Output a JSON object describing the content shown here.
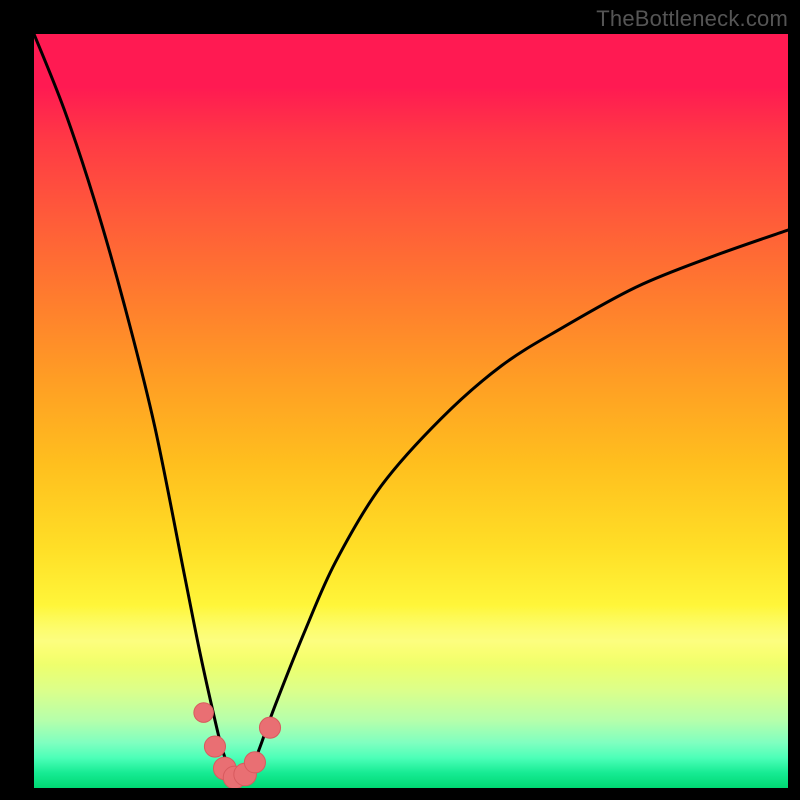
{
  "attribution": "TheBottleneck.com",
  "colors": {
    "curve_stroke": "#000000",
    "marker_fill": "#e96f73",
    "marker_stroke": "#d85a5e",
    "gradient_top": "#ff1a52",
    "gradient_bottom": "#00d873",
    "frame": "#000000"
  },
  "chart_data": {
    "type": "line",
    "title": "",
    "xlabel": "",
    "ylabel": "",
    "xlim": [
      0,
      100
    ],
    "ylim": [
      0,
      100
    ],
    "description": "V-shaped bottleneck curve on a vertical red-to-green gradient. Minimum (optimal, near-zero bottleneck) occurs around x≈27. Left branch rises steeply toward 100 at x=0; right branch rises with diminishing slope toward ~74 at x=100. A cluster of salmon-colored markers sits near the trough.",
    "series": [
      {
        "name": "bottleneck-curve",
        "x": [
          0,
          4,
          8,
          12,
          16,
          20,
          22,
          24,
          25,
          26,
          27,
          28,
          29,
          30,
          32,
          36,
          40,
          46,
          54,
          62,
          70,
          80,
          90,
          100
        ],
        "y": [
          100,
          90,
          78,
          64,
          48,
          28,
          18,
          9,
          5,
          2.5,
          1.3,
          1.6,
          3,
          5.5,
          11,
          21,
          30,
          40,
          49,
          56,
          61,
          66.5,
          70.5,
          74
        ]
      }
    ],
    "markers": [
      {
        "x": 22.5,
        "y": 10.0,
        "r": 1.3
      },
      {
        "x": 24.0,
        "y": 5.5,
        "r": 1.4
      },
      {
        "x": 25.3,
        "y": 2.6,
        "r": 1.5
      },
      {
        "x": 26.6,
        "y": 1.4,
        "r": 1.5
      },
      {
        "x": 28.0,
        "y": 1.8,
        "r": 1.5
      },
      {
        "x": 29.3,
        "y": 3.4,
        "r": 1.4
      },
      {
        "x": 31.3,
        "y": 8.0,
        "r": 1.4
      }
    ]
  }
}
